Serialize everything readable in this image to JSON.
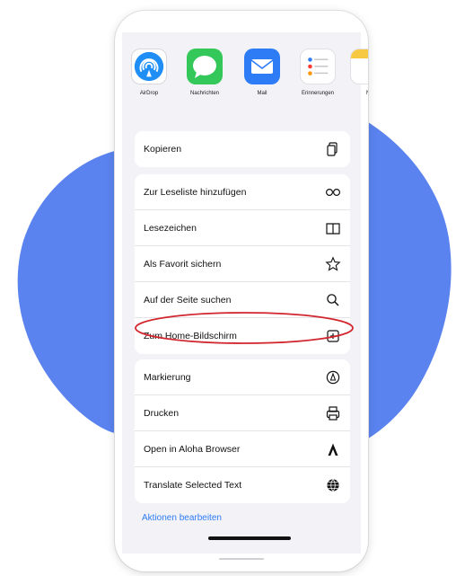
{
  "colors": {
    "accent": "#2f7cf6",
    "blob": "#5a83ef",
    "highlight": "#d2262e"
  },
  "share_sheet": {
    "apps": [
      {
        "label": "AirDrop",
        "icon": "airdrop-icon"
      },
      {
        "label": "Nachrichten",
        "icon": "messages-icon"
      },
      {
        "label": "Mail",
        "icon": "mail-icon"
      },
      {
        "label": "Erinnerungen",
        "icon": "reminders-icon"
      },
      {
        "label": "N",
        "icon": "notes-icon"
      }
    ],
    "actions": [
      {
        "label": "Kopieren",
        "icon": "copy-icon"
      },
      {
        "label": "Zur Leseliste hinzufügen",
        "icon": "reading-list-icon"
      },
      {
        "label": "Lesezeichen",
        "icon": "book-icon"
      },
      {
        "label": "Als Favorit sichern",
        "icon": "star-icon"
      },
      {
        "label": "Auf der Seite suchen",
        "icon": "search-icon"
      },
      {
        "label": "Zum Home-Bildschirm",
        "icon": "add-square-icon"
      },
      {
        "label": "Markierung",
        "icon": "markup-icon"
      },
      {
        "label": "Drucken",
        "icon": "printer-icon"
      },
      {
        "label": "Open in Aloha Browser",
        "icon": "aloha-icon"
      },
      {
        "label": "Translate Selected Text",
        "icon": "globe-icon"
      }
    ],
    "edit_actions_label": "Aktionen bearbeiten"
  }
}
